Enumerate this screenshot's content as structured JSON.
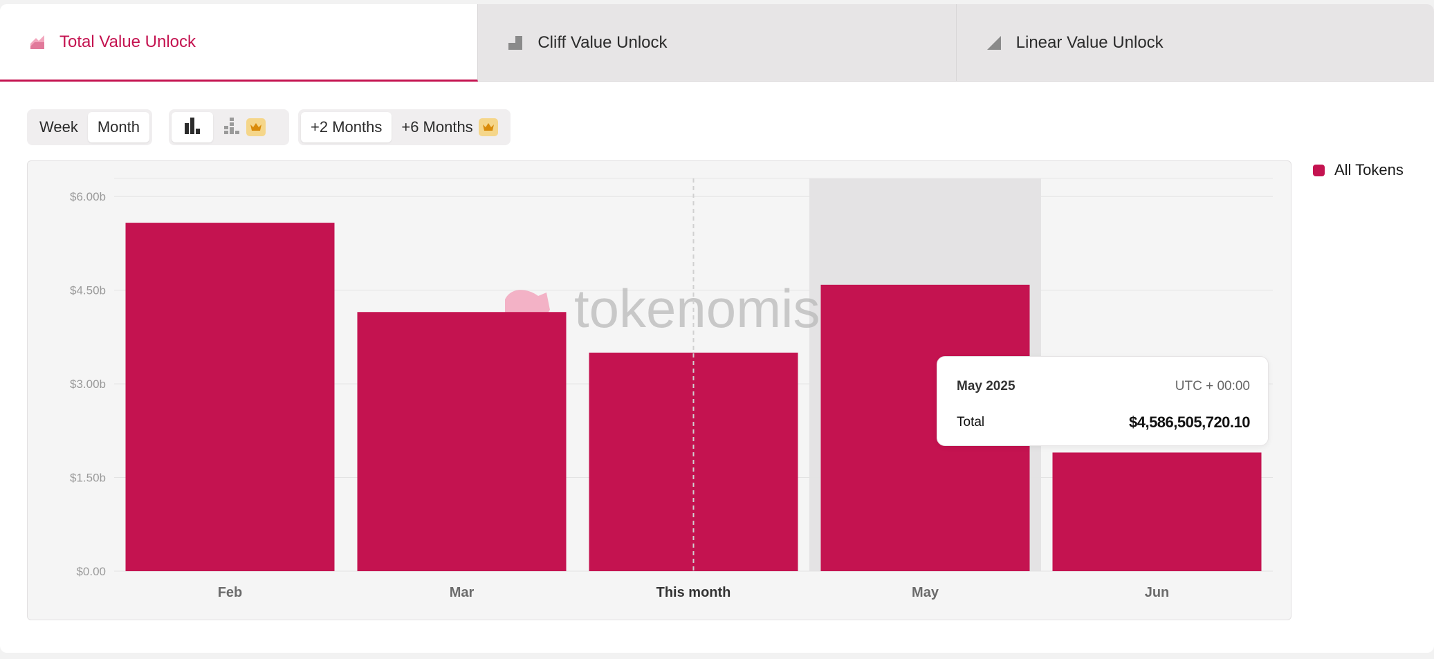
{
  "tabs": [
    {
      "label": "Total Value Unlock",
      "icon": "total-unlock-icon",
      "active": true
    },
    {
      "label": "Cliff Value Unlock",
      "icon": "cliff-unlock-icon",
      "active": false
    },
    {
      "label": "Linear Value Unlock",
      "icon": "linear-unlock-icon",
      "active": false
    }
  ],
  "controls": {
    "granularity": {
      "week_label": "Week",
      "month_label": "Month",
      "selected": "Month"
    },
    "chart_type": {
      "bar_icon": "bar-chart-icon",
      "stacked_icon": "stacked-bar-chart-icon",
      "premium_icon": "crown-icon"
    },
    "range": {
      "two_months_label": "+2 Months",
      "six_months_label": "+6 Months",
      "selected": "+2 Months",
      "premium_icon": "crown-icon"
    }
  },
  "legend": {
    "label": "All Tokens",
    "color": "#c41350"
  },
  "watermark": "tokenomist",
  "tooltip": {
    "title": "May 2025",
    "timezone": "UTC + 00:00",
    "label": "Total",
    "value": "$4,586,505,720.10"
  },
  "colors": {
    "accent": "#c41350",
    "bar": "#c41350",
    "hover_band": "#e4e3e4"
  },
  "chart_data": {
    "type": "bar",
    "categories": [
      "Feb",
      "Mar",
      "This month",
      "May",
      "Jun"
    ],
    "series": [
      {
        "name": "All Tokens",
        "values": [
          5.58,
          4.15,
          3.5,
          4.5865,
          1.9
        ]
      }
    ],
    "y_tick_labels": [
      "$0.00",
      "$1.50b",
      "$3.00b",
      "$4.50b",
      "$6.00b"
    ],
    "y_ticks": [
      0,
      1.5,
      3.0,
      4.5,
      6.0
    ],
    "ylim": [
      0,
      6.0
    ],
    "unit": "billions USD",
    "highlighted_category": "May",
    "current_category": "This month",
    "grid": true
  }
}
